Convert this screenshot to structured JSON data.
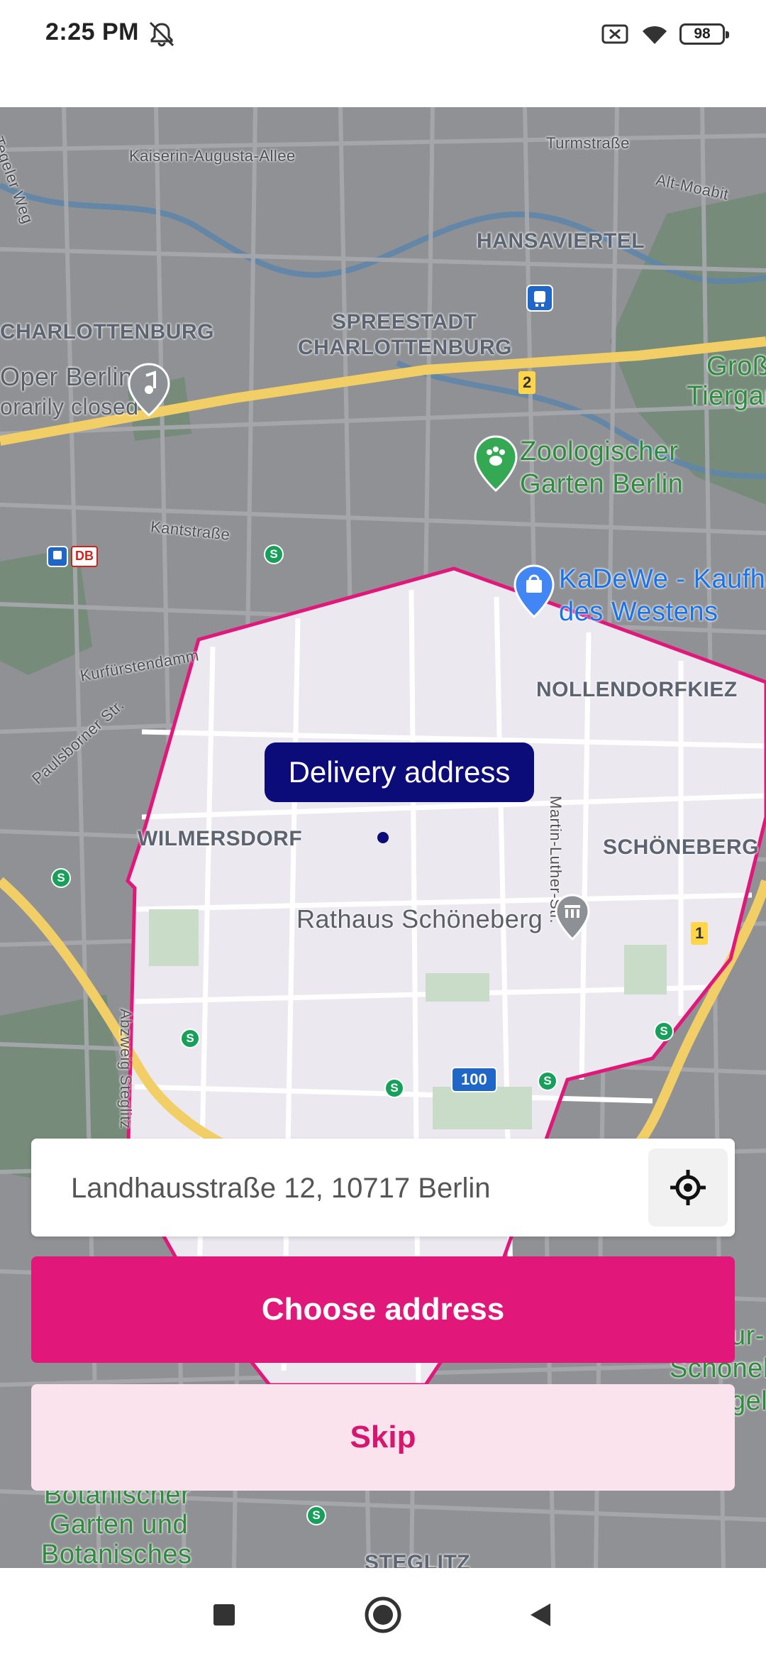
{
  "status_bar": {
    "time": "2:25 PM",
    "battery": "98",
    "icons": [
      "mute-icon",
      "no-sim-icon",
      "wifi-icon",
      "battery-icon"
    ]
  },
  "map": {
    "labels": {
      "teglerweg": "Tegeler Weg",
      "kaiserin": "Kaiserin-Augusta-Allee",
      "turmstrasse": "Turmstraße",
      "altmoabit": "Alt-Moabit",
      "hansaviertel": "HANSAVIERTEL",
      "charlottenburg": "CHARLOTTENBURG",
      "spreestadt_1": "SPREESTADT",
      "spreestadt_2": "CHARLOTTENBURG",
      "oper_1": "Oper Berlin",
      "oper_2": "orarily closed",
      "gross_1": "Groß",
      "gross_2": "Tiergar",
      "zoo_1": "Zoologischer",
      "zoo_2": "Garten Berlin",
      "kantstrasse": "Kantstraße",
      "kadewe_1": "KaDeWe - Kaufha",
      "kadewe_2": "des Westens",
      "kurfuerstendamm": "Kurfürstendamm",
      "paulsborner": "Paulsborner Str.",
      "nollendorfkiez": "NOLLENDORFKIEZ",
      "wilmersdorf": "WILMERSDORF",
      "schoeneberg": "SCHÖNEBERG",
      "martin_luther": "Martin-Luther-Str.",
      "rathaus": "Rathaus Schöneberg",
      "abzweig": "Abzweig Steglitz",
      "botanischer_1": "Botanischer",
      "botanischer_2": "Garten und",
      "botanischer_3": "Botanisches",
      "steglitz": "STEGLITZ",
      "right_1": "ur-",
      "right_2": "Schöneb",
      "right_3": "gel"
    },
    "shields": {
      "a2": "2",
      "a1": "1",
      "b100": "100",
      "db": "DB",
      "s": "S"
    },
    "delivery_tooltip": "Delivery address",
    "colors": {
      "zone_border": "#e2177a",
      "tooltip": "#0b0b7a"
    }
  },
  "controls": {
    "address_value": "Landhausstraße 12, 10717 Berlin",
    "choose_label": "Choose address",
    "skip_label": "Skip",
    "colors": {
      "primary": "#e2177a",
      "secondary_bg": "#fbe3ee"
    }
  },
  "navbar": {
    "buttons": [
      "recents-button",
      "home-button",
      "back-button"
    ]
  }
}
